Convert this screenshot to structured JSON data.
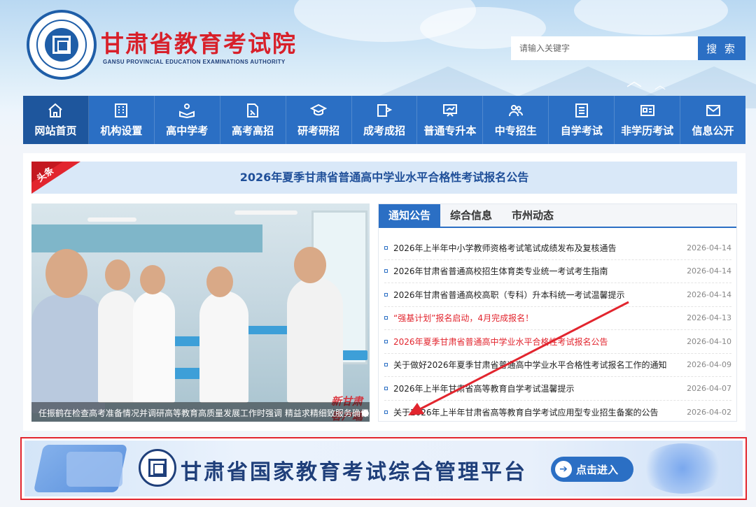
{
  "site": {
    "title": "甘肃省教育考试院",
    "subtitle": "GANSU PROVINCIAL EDUCATION EXAMINATIONS AUTHORITY"
  },
  "search": {
    "placeholder": "请输入关键字",
    "button_label": "搜 索"
  },
  "nav": {
    "items": [
      {
        "label": "网站首页",
        "icon": "home-icon",
        "active": true
      },
      {
        "label": "机构设置",
        "icon": "building-icon"
      },
      {
        "label": "高中学考",
        "icon": "reading-icon"
      },
      {
        "label": "高考高招",
        "icon": "document-pen-icon"
      },
      {
        "label": "研考研招",
        "icon": "graduation-cap-icon"
      },
      {
        "label": "成考成招",
        "icon": "book-flag-icon"
      },
      {
        "label": "普通专升本",
        "icon": "presentation-icon"
      },
      {
        "label": "中专招生",
        "icon": "users-icon"
      },
      {
        "label": "自学考试",
        "icon": "list-icon"
      },
      {
        "label": "非学历考试",
        "icon": "id-card-icon"
      },
      {
        "label": "信息公开",
        "icon": "mail-icon"
      }
    ]
  },
  "headline": {
    "badge": "头条",
    "text": "2026年夏季甘肃省普通高中学业水平合格性考试报名公告"
  },
  "photo": {
    "caption": "任振鹤在检查高考准备情况并调研高等教育高质量发展工作时强调 精益求精细致服务确保高考安全",
    "watermark": "新甘肃客户端"
  },
  "tabs": [
    "通知公告",
    "综合信息",
    "市州动态"
  ],
  "news": [
    {
      "title": "2026年上半年中小学教师资格考试笔试成绩发布及复核通告",
      "date": "2026-04-14",
      "red": false
    },
    {
      "title": "2026年甘肃省普通高校招生体育类专业统一考试考生指南",
      "date": "2026-04-14",
      "red": false
    },
    {
      "title": "2026年甘肃省普通高校高职（专科）升本科统一考试温馨提示",
      "date": "2026-04-14",
      "red": false
    },
    {
      "title": "“强基计划”报名启动，4月完成报名！",
      "date": "2026-04-13",
      "red": true
    },
    {
      "title": "2026年夏季甘肃省普通高中学业水平合格性考试报名公告",
      "date": "2026-04-10",
      "red": true
    },
    {
      "title": "关于做好2026年夏季甘肃省普通高中学业水平合格性考试报名工作的通知",
      "date": "2026-04-09",
      "red": false
    },
    {
      "title": "2026年上半年甘肃省高等教育自学考试温馨提示",
      "date": "2026-04-07",
      "red": false
    },
    {
      "title": "关于2026年上半年甘肃省高等教育自学考试应用型专业招生备案的公告",
      "date": "2026-04-02",
      "red": false
    }
  ],
  "banner": {
    "title": "甘肃省国家教育考试综合管理平台",
    "button_label": "点击进入"
  },
  "colors": {
    "primary_blue": "#2b6fc4",
    "brand_red": "#d8202a",
    "highlight_red": "#e2252e"
  }
}
